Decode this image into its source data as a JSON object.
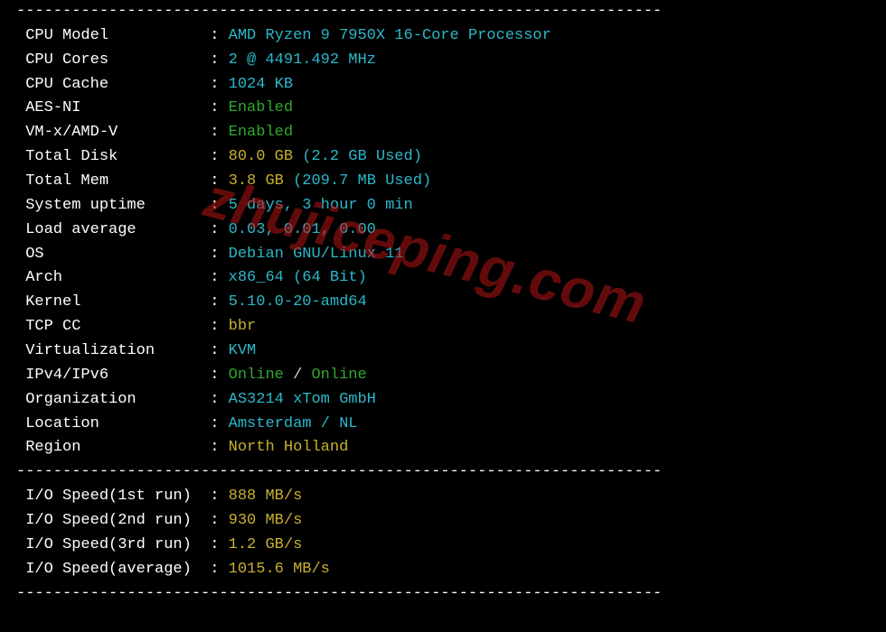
{
  "divider": "----------------------------------------------------------------------",
  "watermark": "zhujiceping.com",
  "rows": [
    {
      "label": "CPU Model",
      "parts": [
        {
          "text": "AMD Ryzen 9 7950X 16-Core Processor",
          "cls": "val-cyan"
        }
      ]
    },
    {
      "label": "CPU Cores",
      "parts": [
        {
          "text": "2 @ 4491.492 MHz",
          "cls": "val-cyan"
        }
      ]
    },
    {
      "label": "CPU Cache",
      "parts": [
        {
          "text": "1024 KB",
          "cls": "val-cyan"
        }
      ]
    },
    {
      "label": "AES-NI",
      "parts": [
        {
          "text": "Enabled",
          "cls": "val-green"
        }
      ]
    },
    {
      "label": "VM-x/AMD-V",
      "parts": [
        {
          "text": "Enabled",
          "cls": "val-green"
        }
      ]
    },
    {
      "label": "Total Disk",
      "parts": [
        {
          "text": "80.0 GB ",
          "cls": "val-yellow"
        },
        {
          "text": "(2.2 GB Used)",
          "cls": "val-cyan"
        }
      ]
    },
    {
      "label": "Total Mem",
      "parts": [
        {
          "text": "3.8 GB ",
          "cls": "val-yellow"
        },
        {
          "text": "(209.7 MB Used)",
          "cls": "val-cyan"
        }
      ]
    },
    {
      "label": "System uptime",
      "parts": [
        {
          "text": "5 days, 3 hour 0 min",
          "cls": "val-cyan"
        }
      ]
    },
    {
      "label": "Load average",
      "parts": [
        {
          "text": "0.03, 0.01, 0.00",
          "cls": "val-cyan"
        }
      ]
    },
    {
      "label": "OS",
      "parts": [
        {
          "text": "Debian GNU/Linux 11",
          "cls": "val-cyan"
        }
      ]
    },
    {
      "label": "Arch",
      "parts": [
        {
          "text": "x86_64 (64 Bit)",
          "cls": "val-cyan"
        }
      ]
    },
    {
      "label": "Kernel",
      "parts": [
        {
          "text": "5.10.0-20-amd64",
          "cls": "val-cyan"
        }
      ]
    },
    {
      "label": "TCP CC",
      "parts": [
        {
          "text": "bbr",
          "cls": "val-yellow"
        }
      ]
    },
    {
      "label": "Virtualization",
      "parts": [
        {
          "text": "KVM",
          "cls": "val-cyan"
        }
      ]
    },
    {
      "label": "IPv4/IPv6",
      "parts": [
        {
          "text": "Online",
          "cls": "val-green"
        },
        {
          "text": " / ",
          "cls": "val-white"
        },
        {
          "text": "Online",
          "cls": "val-green"
        }
      ]
    },
    {
      "label": "Organization",
      "parts": [
        {
          "text": "AS3214 xTom GmbH",
          "cls": "val-cyan"
        }
      ]
    },
    {
      "label": "Location",
      "parts": [
        {
          "text": "Amsterdam / NL",
          "cls": "val-cyan"
        }
      ]
    },
    {
      "label": "Region",
      "parts": [
        {
          "text": "North Holland",
          "cls": "val-yellow"
        }
      ]
    }
  ],
  "io_rows": [
    {
      "label": "I/O Speed(1st run)",
      "parts": [
        {
          "text": "888 MB/s",
          "cls": "val-yellow"
        }
      ]
    },
    {
      "label": "I/O Speed(2nd run)",
      "parts": [
        {
          "text": "930 MB/s",
          "cls": "val-yellow"
        }
      ]
    },
    {
      "label": "I/O Speed(3rd run)",
      "parts": [
        {
          "text": "1.2 GB/s",
          "cls": "val-yellow"
        }
      ]
    },
    {
      "label": "I/O Speed(average)",
      "parts": [
        {
          "text": "1015.6 MB/s",
          "cls": "val-yellow"
        }
      ]
    }
  ]
}
